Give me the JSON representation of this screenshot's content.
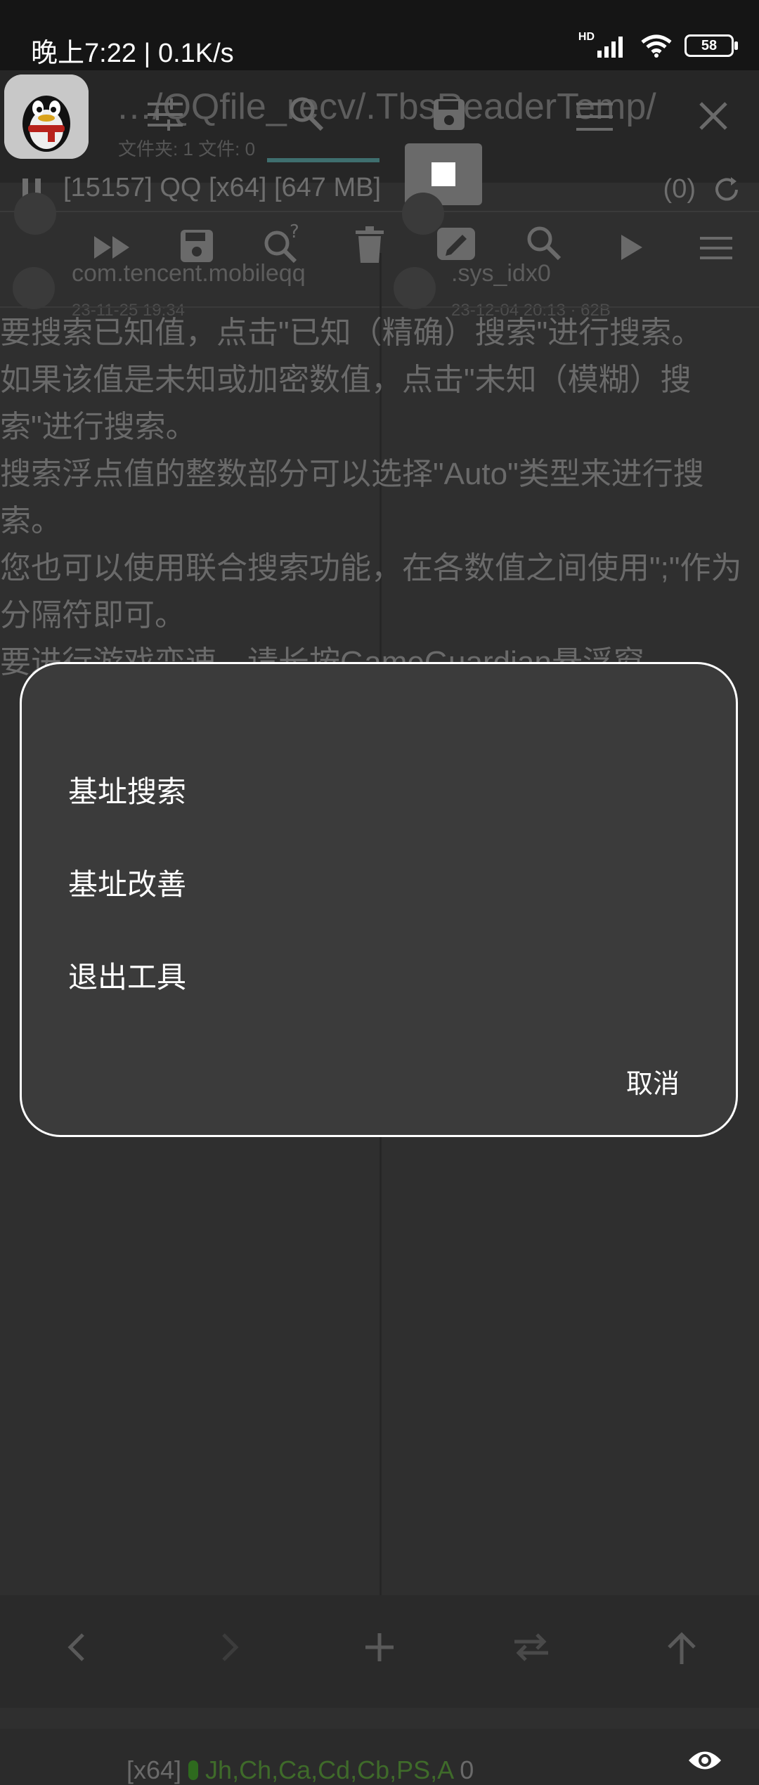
{
  "status_bar": {
    "time_speed": "晚上7:22 | 0.1K/s",
    "hd": "HD",
    "battery": "58"
  },
  "app": {
    "path": "…/QQfile_recv/.TbsReaderTemp/",
    "count": "文件夹: 1  文件: 0",
    "process": "[15157] QQ [x64] [647 MB]",
    "result_count": "(0)"
  },
  "files": [
    {
      "name": "com.tencent.mobileqq",
      "date": "23-11-25 19:34"
    },
    {
      "name": ".sys_idx0",
      "date": "23-12-04 20:13 · 62B"
    }
  ],
  "help_text": [
    "要搜索已知值，点击\"已知（精确）搜索\"进行搜索。",
    "如果该值是未知或加密数值，点击\"未知（模糊）搜索\"进行搜索。",
    "搜索浮点值的整数部分可以选择\"Auto\"类型来进行搜索。",
    "您也可以使用联合搜索功能，在各数值之间使用\";\"作为分隔符即可。",
    "要进行游戏变速，请长按GameGuardian悬浮窗。"
  ],
  "bottom_status": {
    "arch": "[x64]",
    "regions": "Jh,Ch,Ca,Cd,Cb,PS,A",
    "count": "0"
  },
  "dialog": {
    "items": [
      "基址搜索",
      "基址改善",
      "退出工具"
    ],
    "cancel": "取消"
  }
}
